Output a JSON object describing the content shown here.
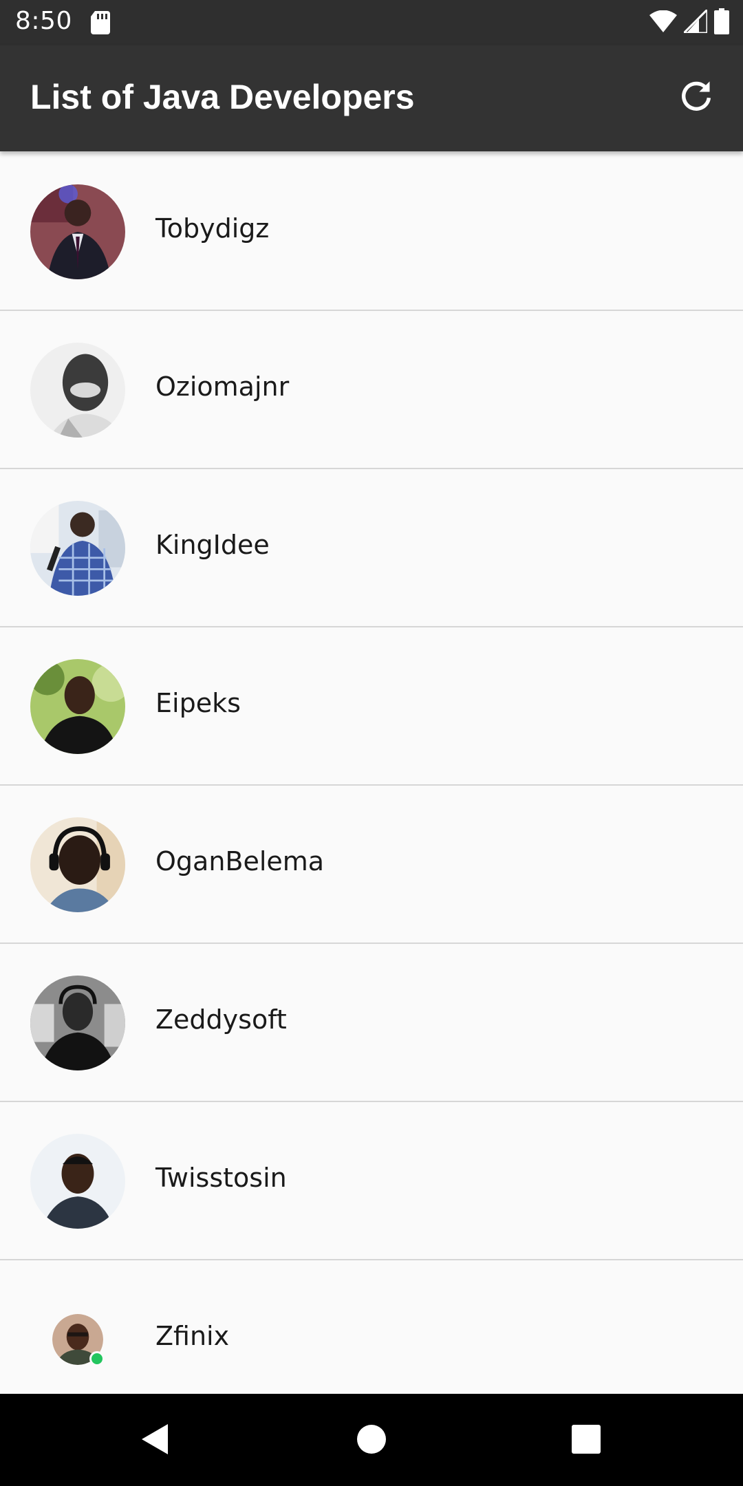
{
  "status_bar": {
    "time": "8:50",
    "icons": [
      "sd-card-icon",
      "wifi-icon",
      "signal-icon",
      "battery-icon"
    ]
  },
  "app_bar": {
    "title": "List of Java Developers",
    "refresh_icon": "refresh-icon"
  },
  "developers": [
    {
      "name": "Tobydigz"
    },
    {
      "name": "Oziomajnr"
    },
    {
      "name": "KingIdee"
    },
    {
      "name": "Eipeks"
    },
    {
      "name": "OganBelema"
    },
    {
      "name": "Zeddysoft"
    },
    {
      "name": "Twisstosin"
    },
    {
      "name": "Zfinix"
    }
  ],
  "nav_bar": {
    "icons": [
      "back-icon",
      "home-icon",
      "recents-icon"
    ]
  },
  "colors": {
    "app_bar": "#333333",
    "status_bar": "#2f2f2f",
    "list_background": "#fafafa",
    "divider": "#d6d6d6",
    "online_dot": "#22c55e"
  }
}
